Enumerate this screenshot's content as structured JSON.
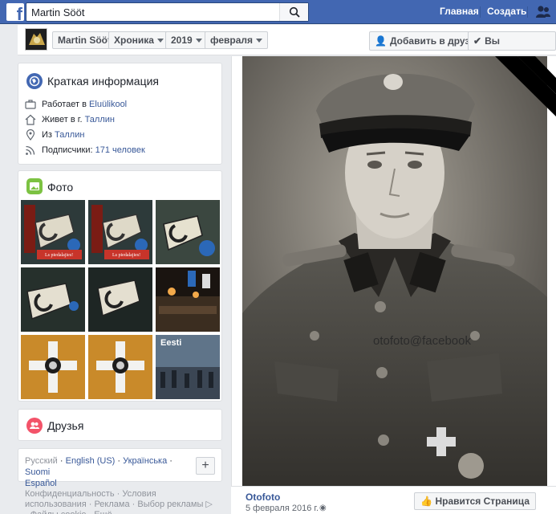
{
  "topbar": {
    "search_value": "Martin Sööt",
    "home_label": "Главная",
    "create_label": "Создать"
  },
  "profile": {
    "name": "Martin Sööt",
    "timeline_label": "Хроника",
    "year": "2019",
    "month": "февраля",
    "add_friend_label": "Добавить в друзья",
    "subscribed_label": "Вы подписаны"
  },
  "intro": {
    "title": "Краткая информация",
    "work_prefix": "Работает в ",
    "work_link": "Eluülikool",
    "lives_prefix": "Живет в г. ",
    "lives_link": "Таллин",
    "from_prefix": "Из ",
    "from_link": "Таллин",
    "followers_prefix": "Подписчики: ",
    "followers_link": "171 человек"
  },
  "photos": {
    "title": "Фото",
    "caption_overlay": "Ls piedalajies!",
    "caption_overlay2": "Ls piedalajies!",
    "tile_text": "Eesti"
  },
  "friends": {
    "title": "Друзья"
  },
  "languages": {
    "current": "Русский",
    "items": [
      "English (US)",
      "Українська",
      "Suomi",
      "Español"
    ]
  },
  "footer": {
    "text": "Конфиденциальность · Условия использования · Реклама · Выбор рекламы ▷ · Файлы cookie · Ещё"
  },
  "post": {
    "watermark": "otofoto@facebook",
    "author": "Otofoto",
    "date": "5 февраля 2016 г. ·",
    "like_page_label": "Нравится Страница"
  },
  "colors": {
    "brand": "#4267b2",
    "link": "#385898",
    "intro_icon": "#4267b2",
    "photos_icon": "#7cc242",
    "friends_icon": "#f35369"
  }
}
